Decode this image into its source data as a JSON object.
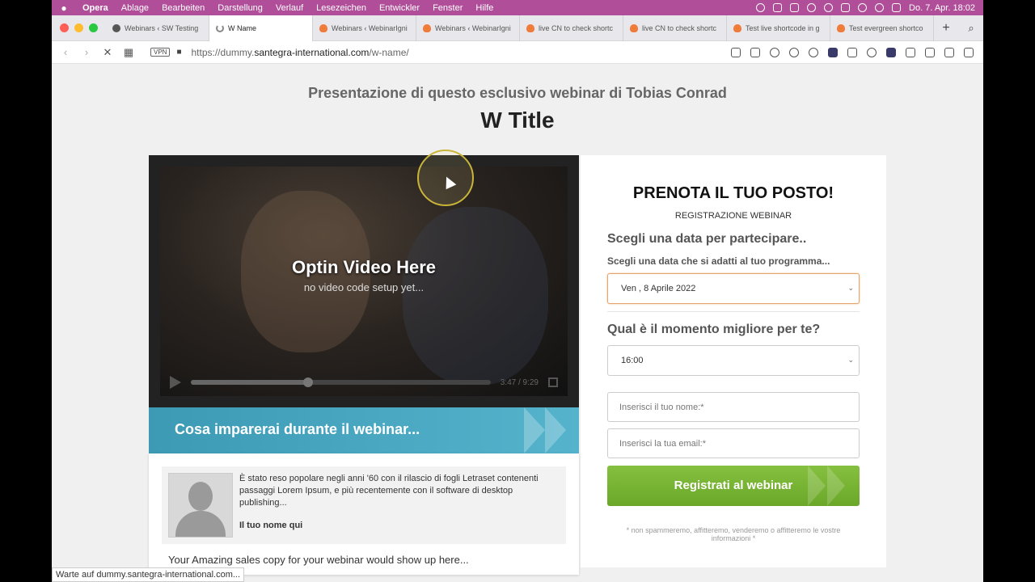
{
  "menubar": {
    "app": "Opera",
    "items": [
      "Ablage",
      "Bearbeiten",
      "Darstellung",
      "Verlauf",
      "Lesezeichen",
      "Entwickler",
      "Fenster",
      "Hilfe"
    ],
    "clock": "Do. 7. Apr.  18:02"
  },
  "tabs": [
    {
      "label": "Webinars ‹ SW Testing",
      "icon": "globe-icon"
    },
    {
      "label": "W Name",
      "icon": "loading-icon"
    },
    {
      "label": "Webinars ‹ WebinarIgni",
      "icon": "flame-icon"
    },
    {
      "label": "Webinars ‹ WebinarIgni",
      "icon": "flame-icon"
    },
    {
      "label": "live CN to check shortc",
      "icon": "flame-icon"
    },
    {
      "label": "live CN to check shortc",
      "icon": "flame-icon"
    },
    {
      "label": "Test live shortcode in g",
      "icon": "flame-icon"
    },
    {
      "label": "Test evergreen shortco",
      "icon": "flame-icon"
    }
  ],
  "address": {
    "vpn": "VPN",
    "url_prefix": "https://dummy.",
    "url_domain": "santegra-international.com",
    "url_path": "/w-name/"
  },
  "page": {
    "presenter": "Presentazione di questo esclusivo webinar di Tobias Conrad",
    "title": "W Title",
    "video": {
      "headline": "Optin Video Here",
      "subline": "no video code setup yet...",
      "time": "3:47 / 9:29",
      "progress": 0.39
    },
    "learn_banner": "Cosa imparerai durante il webinar...",
    "testimonial": {
      "text": "È stato reso popolare negli anni '60 con il rilascio di fogli Letraset contenenti passaggi Lorem Ipsum, e più recentemente con il software di desktop publishing...",
      "name": "Il tuo nome qui"
    },
    "sales_copy": "Your Amazing sales copy for your webinar would show up here..."
  },
  "form": {
    "heading": "PRENOTA IL TUO POSTO!",
    "subheading": "REGISTRAZIONE WEBINAR",
    "date_title": "Scegli una data per partecipare..",
    "date_subtitle": "Scegli una data che si adatti al tuo programma...",
    "date_value": "Ven , 8 Aprile 2022",
    "time_title": "Qual è il momento migliore per te?",
    "time_value": "16:00",
    "name_placeholder": "Inserisci il tuo nome:*",
    "email_placeholder": "Inserisci la tua email:*",
    "submit": "Registrati al webinar",
    "disclaimer": "* non spammeremo, affitteremo, venderemo o affitteremo le vostre informazioni *"
  },
  "status": "Warte auf dummy.santegra-international.com..."
}
